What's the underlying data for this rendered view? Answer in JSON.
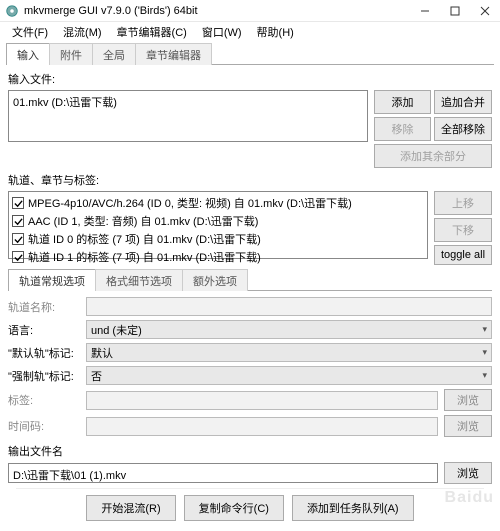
{
  "window": {
    "title": "mkvmerge GUI v7.9.0 ('Birds') 64bit"
  },
  "menu": {
    "file": "文件(F)",
    "mux": "混流(M)",
    "chapter": "章节编辑器(C)",
    "window": "窗口(W)",
    "help": "帮助(H)"
  },
  "tabs": {
    "input": "输入",
    "attach": "附件",
    "global": "全局",
    "chapter": "章节编辑器"
  },
  "input": {
    "files_label": "输入文件:",
    "file0": "01.mkv (D:\\迅雷下载)",
    "btn_add": "添加",
    "btn_append": "追加合并",
    "btn_remove": "移除",
    "btn_remove_all": "全部移除",
    "btn_add_rest": "添加其余部分"
  },
  "tracks": {
    "label": "轨道、章节与标签:",
    "t0": "MPEG-4p10/AVC/h.264 (ID 0, 类型: 视频) 自 01.mkv (D:\\迅雷下载)",
    "t1": "AAC (ID 1, 类型: 音频) 自 01.mkv (D:\\迅雷下载)",
    "t2": "轨道 ID 0 的标签 (7 项) 自 01.mkv (D:\\迅雷下载)",
    "t3": "轨道 ID 1 的标签 (7 项) 自 01.mkv (D:\\迅雷下载)",
    "btn_up": "上移",
    "btn_down": "下移",
    "btn_toggle": "toggle all"
  },
  "subtabs": {
    "general": "轨道常规选项",
    "format": "格式细节选项",
    "extra": "额外选项"
  },
  "form": {
    "name_lbl": "轨道名称:",
    "lang_lbl": "语言:",
    "lang_val": "und (未定)",
    "default_lbl": "\"默认轨\"标记:",
    "default_val": "默认",
    "forced_lbl": "\"强制轨\"标记:",
    "forced_val": "否",
    "tags_lbl": "标签:",
    "browse": "浏览",
    "time_lbl": "时间码:"
  },
  "output": {
    "label": "输出文件名",
    "path": "D:\\迅雷下载\\01 (1).mkv",
    "browse": "浏览"
  },
  "bottom": {
    "start": "开始混流(R)",
    "copy": "复制命令行(C)",
    "queue": "添加到任务队列(A)"
  }
}
